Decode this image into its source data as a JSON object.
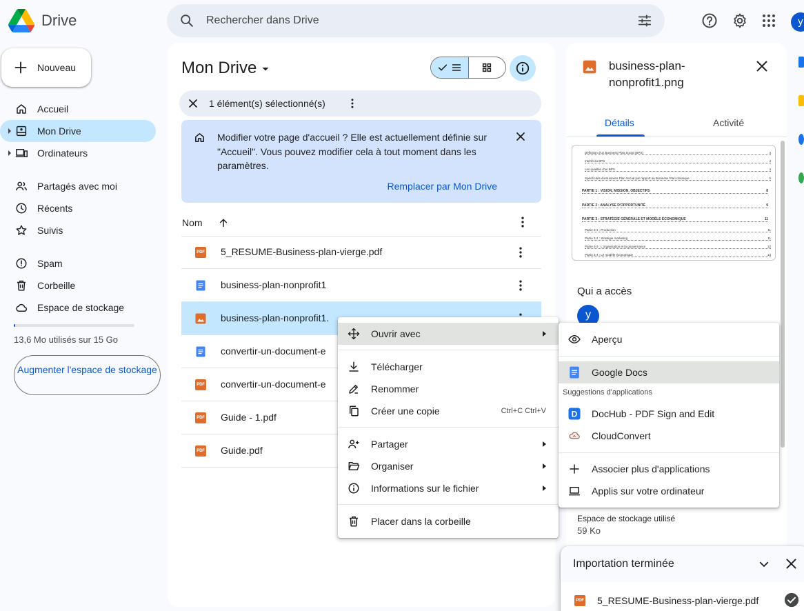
{
  "app": {
    "name": "Drive"
  },
  "search": {
    "placeholder": "Rechercher dans Drive"
  },
  "user": {
    "initial": "y"
  },
  "sidebar": {
    "new_label": "Nouveau",
    "items": [
      {
        "label": "Accueil"
      },
      {
        "label": "Mon Drive"
      },
      {
        "label": "Ordinateurs"
      },
      {
        "label": "Partagés avec moi"
      },
      {
        "label": "Récents"
      },
      {
        "label": "Suivis"
      },
      {
        "label": "Spam"
      },
      {
        "label": "Corbeille"
      },
      {
        "label": "Espace de stockage"
      }
    ],
    "storage_text": "13,6 Mo utilisés sur 15 Go",
    "storage_fraction": 0.0009,
    "upgrade_label": "Augmenter l'espace de stockage"
  },
  "main": {
    "title": "Mon Drive",
    "selection_text": "1 élément(s) sélectionné(s)",
    "banner": {
      "bold": "Modifier votre page d'accueil ?",
      "text": " Elle est actuellement définie sur \"Accueil\". Vous pouvez modifier cela à tout moment dans les paramètres.",
      "action": "Remplacer par Mon Drive"
    },
    "column_name": "Nom",
    "files": [
      {
        "name": "5_RESUME-Business-plan-vierge.pdf",
        "type": "pdf"
      },
      {
        "name": "business-plan-nonprofit1",
        "type": "doc"
      },
      {
        "name": "business-plan-nonprofit1.",
        "type": "image"
      },
      {
        "name": "convertir-un-document-e",
        "type": "doc"
      },
      {
        "name": "convertir-un-document-e",
        "type": "pdf"
      },
      {
        "name": "Guide - 1.pdf",
        "type": "pdf"
      },
      {
        "name": "Guide.pdf",
        "type": "pdf"
      }
    ]
  },
  "details": {
    "file_name": "business-plan-nonprofit1.png",
    "tab_details": "Détails",
    "tab_activity": "Activité",
    "thumbnail_lines": [
      {
        "text": "Définition d'un Business Plan Social (BPS)",
        "page": "4"
      },
      {
        "text": "Intérêt du BPS",
        "page": "4"
      },
      {
        "text": "Les qualités d'un BPS",
        "page": "4"
      },
      {
        "text": "Spécificités du Business Plan Social par rapport au Business Plan classique",
        "page": "5"
      },
      {
        "text": "PARTIE 1 : VISION, MISSION, OBJECTIFS",
        "page": "8"
      },
      {
        "text": "PARTIE 2 : ANALYSE D'OPPORTUNITÉ",
        "page": "9"
      },
      {
        "text": "PARTIE 3 : STRATÉGIE GÉNÉRALE ET MODÈLE ÉCONOMIQUE",
        "page": "11"
      },
      {
        "text": "Partie 3-1 : Production",
        "page": "11"
      },
      {
        "text": "Partie 3-2 : Stratégie marketing",
        "page": "11"
      },
      {
        "text": "Partie 3-3 : L'organisation et la gouvernance",
        "page": "12"
      },
      {
        "text": "Partie 3-4 : Le modèle économique",
        "page": "13"
      }
    ],
    "access_title": "Qui a accès",
    "access_initial": "y",
    "storage_label": "Espace de stockage utilisé",
    "storage_value": "59 Ko"
  },
  "context_menu": {
    "open_with": "Ouvrir avec",
    "download": "Télécharger",
    "rename": "Renommer",
    "copy": "Créer une copie",
    "copy_shortcut": "Ctrl+C Ctrl+V",
    "share": "Partager",
    "organize": "Organiser",
    "file_info": "Informations sur le fichier",
    "trash": "Placer dans la corbeille"
  },
  "open_with_menu": {
    "preview": "Aperçu",
    "google_docs": "Google Docs",
    "suggestions_heading": "Suggestions d'applications",
    "dochub": "DocHub - PDF Sign and Edit",
    "cloudconvert": "CloudConvert",
    "more_apps": "Associer plus d'applications",
    "computer_apps": "Applis sur votre ordinateur"
  },
  "upload": {
    "title": "Importation terminée",
    "file_name": "5_RESUME-Business-plan-vierge.pdf"
  },
  "colors": {
    "accent": "#0b57d0",
    "selected": "#c2e7ff",
    "banner": "#d3e3fd",
    "pdf": "#ea4335",
    "doc": "#4285f4"
  }
}
